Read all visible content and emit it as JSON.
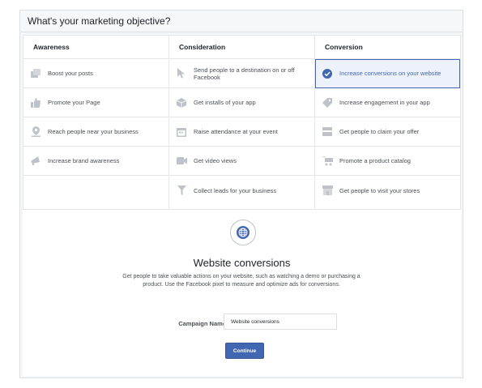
{
  "header": {
    "title": "What's your marketing objective?"
  },
  "columns": [
    {
      "title": "Awareness",
      "items": [
        {
          "label": "Boost your posts",
          "icon": "boost-posts-icon"
        },
        {
          "label": "Promote your Page",
          "icon": "thumbs-up-icon"
        },
        {
          "label": "Reach people near your business",
          "icon": "location-pin-icon"
        },
        {
          "label": "Increase brand awareness",
          "icon": "megaphone-icon"
        }
      ]
    },
    {
      "title": "Consideration",
      "items": [
        {
          "label": "Send people to a destination on or off Facebook",
          "icon": "cursor-icon"
        },
        {
          "label": "Get installs of your app",
          "icon": "box-icon"
        },
        {
          "label": "Raise attendance at your event",
          "icon": "calendar-icon"
        },
        {
          "label": "Get video views",
          "icon": "video-camera-icon"
        },
        {
          "label": "Collect leads for your business",
          "icon": "funnel-icon"
        }
      ]
    },
    {
      "title": "Conversion",
      "items": [
        {
          "label": "Increase conversions on your website",
          "icon": "check-circle-icon",
          "selected": true
        },
        {
          "label": "Increase engagement in your app",
          "icon": "tag-icon"
        },
        {
          "label": "Get people to claim your offer",
          "icon": "offer-card-icon"
        },
        {
          "label": "Promote a product catalog",
          "icon": "shopping-cart-icon"
        },
        {
          "label": "Get people to visit your stores",
          "icon": "store-icon"
        }
      ]
    }
  ],
  "detail": {
    "icon": "globe-icon",
    "title": "Website conversions",
    "description": "Get people to take valuable actions on your website, such as watching a demo or purchasing a product. Use the Facebook pixel to measure and optimize ads for conversions.",
    "campaign_name_label": "Campaign Name",
    "campaign_name_value": "Website conversions",
    "continue_label": "Continue"
  },
  "colors": {
    "accent": "#4267b2",
    "icon_gray": "#bec3c9",
    "selected_bg": "#edf2fa"
  }
}
